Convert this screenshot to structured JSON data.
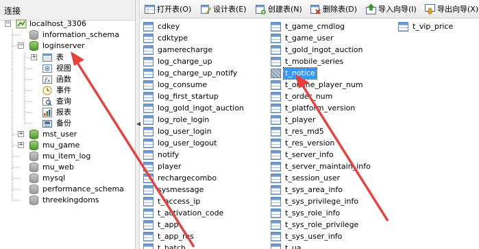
{
  "navigator": {
    "header": "连接",
    "connection": "localhost_3306",
    "databases": [
      "information_schema",
      "loginserver",
      "mst_user",
      "mu_game",
      "mu_item_log",
      "mu_web",
      "mysql",
      "performance_schema",
      "threekingdoms"
    ],
    "expanded_database": "loginserver",
    "object_types": [
      "表",
      "视图",
      "函数",
      "事件",
      "查询",
      "报表",
      "备份"
    ]
  },
  "toolbar": {
    "open_table": "打开表(O)",
    "design_table": "设计表(E)",
    "new_table": "创建表(N)",
    "delete_table": "删除表(D)",
    "import_wizard": "导入向导(I)",
    "export_wizard": "导出向导(X)"
  },
  "tables": {
    "col1": [
      "cdkey",
      "cdktype",
      "gamerecharge",
      "log_charge_up",
      "log_charge_up_notify",
      "log_consume",
      "log_first_startup",
      "log_gold_ingot_auction",
      "log_role_login",
      "log_user_login",
      "log_user_logout",
      "notify",
      "player",
      "rechargecombo",
      "sysmessage",
      "t_access_ip",
      "t_activation_code",
      "t_app",
      "t_app_res",
      "t_batch"
    ],
    "col2": [
      "t_game_cmdlog",
      "t_game_user",
      "t_gold_ingot_auction",
      "t_mobile_series",
      "t_notice",
      "t_online_player_num",
      "t_order_num",
      "t_platform_version",
      "t_player",
      "t_res_md5",
      "t_res_version",
      "t_server_info",
      "t_server_maintain_info",
      "t_session_user",
      "t_sys_area_info",
      "t_sys_privilege_info",
      "t_sys_role_info",
      "t_sys_role_privilege",
      "t_sys_user_info",
      "t_ua"
    ],
    "col3": [
      "t_vip_price"
    ],
    "selected": "t_notice"
  },
  "colors": {
    "selection": "#3399ff",
    "annotation_arrow": "#e8413c",
    "db_active": "#4c9a2a"
  }
}
